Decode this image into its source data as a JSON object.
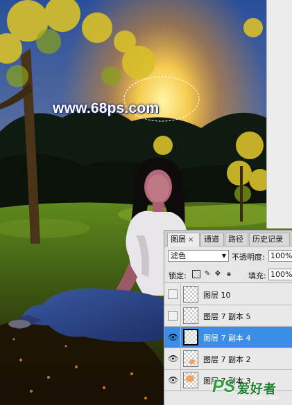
{
  "watermark": "www.68ps.com",
  "layers_panel": {
    "tabs": [
      {
        "label": "图层",
        "close": "×",
        "active": true
      },
      {
        "label": "通道"
      },
      {
        "label": "路径"
      },
      {
        "label": "历史记录"
      }
    ],
    "blend_mode": "滤色",
    "opacity_label": "不透明度:",
    "opacity_value": "100%",
    "lock_label": "锁定:",
    "fill_label": "填充:",
    "fill_value": "100%",
    "layers": [
      {
        "name": "图层 10",
        "visible": false,
        "selected": false
      },
      {
        "name": "图层 7 副本 5",
        "visible": false,
        "selected": false
      },
      {
        "name": "图层 7 副本 4",
        "visible": true,
        "selected": true
      },
      {
        "name": "图层 7 副本 2",
        "visible": true,
        "selected": false
      },
      {
        "name": "图层 7 副本 3",
        "visible": true,
        "selected": false
      }
    ]
  },
  "site_logo": {
    "ps": "PS",
    "text": "爱好者",
    "url": "www.psahz.com"
  },
  "icons": {
    "eye": "eye-icon",
    "dropdown": "chevron-down-icon",
    "lock_transparent": "lock-transparent-pixels-icon",
    "lock_paint": "brush-icon",
    "lock_move": "move-icon",
    "lock_all": "lock-icon"
  },
  "colors": {
    "selection": "#3a8ee6",
    "panel_bg": "#e6e6e6",
    "logo_green": "#2f9e3d"
  }
}
